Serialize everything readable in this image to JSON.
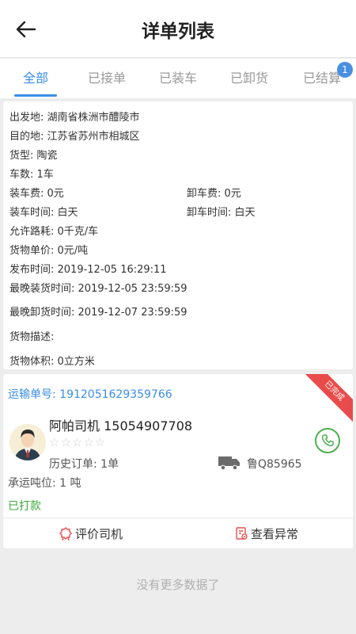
{
  "header": {
    "title": "详单列表",
    "back_icon": "arrow-left-icon"
  },
  "tabs": [
    {
      "label": "全部",
      "active": true
    },
    {
      "label": "已接单",
      "active": false
    },
    {
      "label": "已装车",
      "active": false
    },
    {
      "label": "已卸货",
      "active": false
    },
    {
      "label": "已结算",
      "active": false
    }
  ],
  "tab_badge": "1",
  "order": {
    "origin": "出发地: 湖南省株洲市醴陵市",
    "destination": "目的地: 江苏省苏州市相城区",
    "goods_type": "货型: 陶瓷",
    "vehicles": "车数: 1车",
    "loading_fee": "装车费: 0元",
    "unloading_fee": "卸车费: 0元",
    "loading_time": "装车时间: 白天",
    "unloading_time": "卸车时间: 白天",
    "loss_allowance": "允许路耗: 0千克/车",
    "unit_price": "货物单价: 0元/吨",
    "publish_time": "发布时间: 2019-12-05 16:29:11",
    "latest_loading": "最晚装货时间: 2019-12-05 23:59:59",
    "latest_unloading": "最晚卸货时间: 2019-12-07 23:59:59",
    "description": "货物描述:",
    "volume": "货物体积: 0立方米"
  },
  "waybill": {
    "number": "运输单号: 1912051629359766",
    "status_ribbon": "已完成",
    "driver_name": "阿帕司机  15054907708",
    "rating": "☆☆☆☆☆",
    "history": "历史订单: 1单",
    "plate": "鲁Q85965",
    "tonnage": "承运吨位: 1 吨",
    "payment": "已打款",
    "rate_label": "评价司机",
    "exception_label": "查看异常"
  },
  "footer": {
    "no_more": "没有更多数据了"
  },
  "colors": {
    "accent": "#3a8ee6",
    "ribbon": "#e94b4b",
    "paid": "#3aa83a",
    "phone": "#4caf50"
  }
}
